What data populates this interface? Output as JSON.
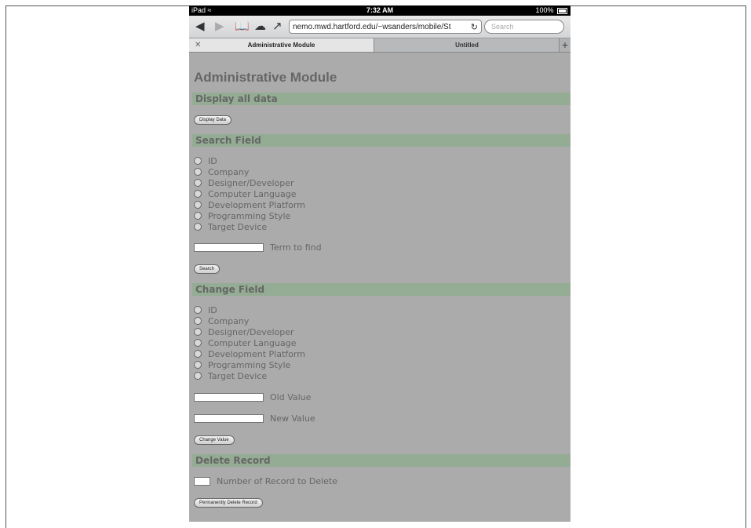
{
  "status_bar": {
    "device": "iPad",
    "wifi_icon": "wifi-icon",
    "time": "7:32 AM",
    "battery": "100%"
  },
  "toolbar": {
    "url": "nemo.mwd.hartford.edu/~wsanders/mobile/St",
    "search_placeholder": "Search"
  },
  "tabs": [
    {
      "label": "Administrative Module",
      "active": true
    },
    {
      "label": "Untitled",
      "active": false
    }
  ],
  "page": {
    "title": "Administrative Module",
    "display_section": {
      "heading": "Display all data",
      "button": "Display Data"
    },
    "search_section": {
      "heading": "Search Field",
      "options": [
        "ID",
        "Company",
        "Designer/Developer",
        "Computer Language",
        "Development Platform",
        "Programming Style",
        "Target Device"
      ],
      "term_label": "Term to find",
      "button": "Search"
    },
    "change_section": {
      "heading": "Change Field",
      "options": [
        "ID",
        "Company",
        "Designer/Developer",
        "Computer Language",
        "Development Platform",
        "Programming Style",
        "Target Device"
      ],
      "old_label": "Old Value",
      "new_label": "New Value",
      "button": "Change Value"
    },
    "delete_section": {
      "heading": "Delete Record",
      "number_label": "Number of Record to Delete",
      "button": "Permanently Delete Record"
    }
  },
  "colors": {
    "page_bg": "#ababab",
    "section_bg": "#93ac93"
  }
}
